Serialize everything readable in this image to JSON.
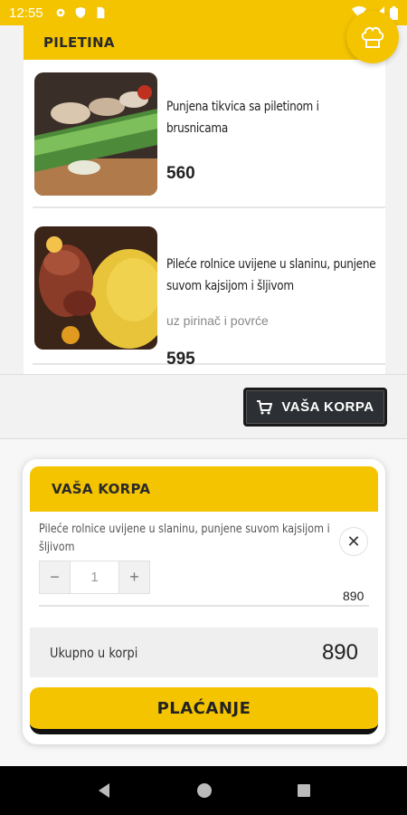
{
  "status_bar": {
    "time": "12:55",
    "left_icons": [
      "gear-icon",
      "shield-icon",
      "sim-icon"
    ],
    "right_icons": [
      "wifi-icon",
      "signal-icon",
      "battery-icon"
    ]
  },
  "menu": {
    "category": "PILETINA",
    "chef_icon": "chef-hat-icon",
    "items": [
      {
        "name": "Punjena tikvica sa piletinom i brusnicama",
        "description": "",
        "price": "560"
      },
      {
        "name": "Pileće rolnice uvijene u slaninu, punjene suvom kajsijom i šljivom",
        "description": "uz pirinač i povrće",
        "price": "595"
      }
    ]
  },
  "cart_button": {
    "label": "VAŠA KORPA",
    "icon": "cart-icon"
  },
  "cart": {
    "title": "VAŠA KORPA",
    "items": [
      {
        "name": "Pileće rolnice uvijene u slaninu, punjene suvom kajsijom i šljivom",
        "quantity": "1",
        "price": "890",
        "decrement": "−",
        "increment": "+",
        "remove": "✕"
      }
    ],
    "total_label": "Ukupno u korpi",
    "total_value": "890",
    "checkout_label": "PLAĆANJE"
  },
  "colors": {
    "accent": "#f4c400",
    "dark_button": "#2c2f33"
  }
}
